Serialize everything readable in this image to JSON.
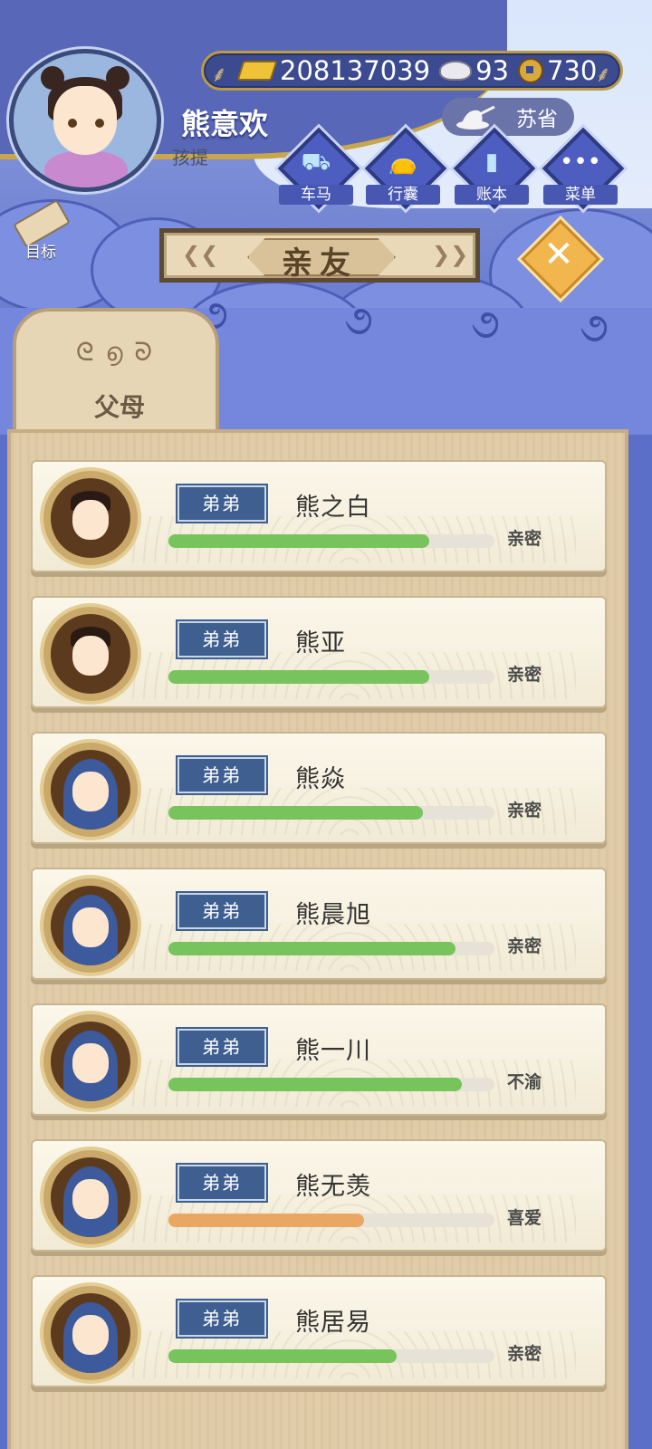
{
  "player": {
    "name": "熊意欢",
    "title": "孩提"
  },
  "currency": {
    "gold": "208137039",
    "silver": "93",
    "coins": "730"
  },
  "location": {
    "province": "苏省"
  },
  "menu": [
    {
      "label": "车马",
      "icon": "carriage-icon"
    },
    {
      "label": "行囊",
      "icon": "bag-icon"
    },
    {
      "label": "账本",
      "icon": "ledger-icon"
    },
    {
      "label": "菜单",
      "icon": "more-icon"
    }
  ],
  "goal": {
    "label": "目标"
  },
  "page": {
    "title": "亲友"
  },
  "tab": {
    "label": "父母"
  },
  "relatives": [
    {
      "relation": "弟弟",
      "name": "熊之白",
      "bar": 0.8,
      "status": "亲密",
      "bar_color": "#76c45b"
    },
    {
      "relation": "弟弟",
      "name": "熊亚",
      "bar": 0.8,
      "status": "亲密",
      "bar_color": "#76c45b"
    },
    {
      "relation": "弟弟",
      "name": "熊焱",
      "bar": 0.78,
      "status": "亲密",
      "bar_color": "#76c45b"
    },
    {
      "relation": "弟弟",
      "name": "熊晨旭",
      "bar": 0.88,
      "status": "亲密",
      "bar_color": "#76c45b"
    },
    {
      "relation": "弟弟",
      "name": "熊一川",
      "bar": 0.9,
      "status": "不渝",
      "bar_color": "#76c45b"
    },
    {
      "relation": "弟弟",
      "name": "熊无羡",
      "bar": 0.6,
      "status": "喜爱",
      "bar_color": "#eaa763"
    },
    {
      "relation": "弟弟",
      "name": "熊居易",
      "bar": 0.7,
      "status": "亲密",
      "bar_color": "#76c45b"
    }
  ]
}
